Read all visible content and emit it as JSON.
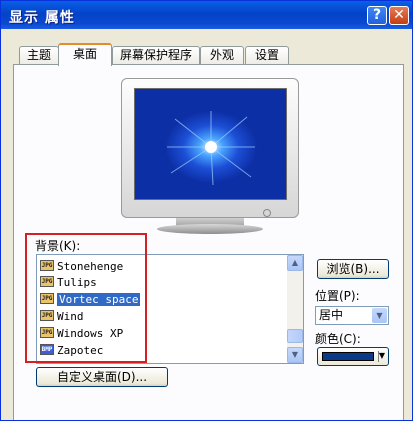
{
  "window": {
    "title": "显示 属性",
    "help_label": "?",
    "close_label": "✕"
  },
  "tabs": [
    {
      "label": "主题"
    },
    {
      "label": "桌面"
    },
    {
      "label": "屏幕保护程序"
    },
    {
      "label": "外观"
    },
    {
      "label": "设置"
    }
  ],
  "active_tab": "桌面",
  "preview": {
    "monitor_icon": "monitor-preview",
    "wallpaper": "Vortec space"
  },
  "background": {
    "label": "背景(K):",
    "items": [
      {
        "name": "Stonehenge",
        "type": "JPG"
      },
      {
        "name": "Tulips",
        "type": "JPG"
      },
      {
        "name": "Vortec space",
        "type": "JPG",
        "selected": true
      },
      {
        "name": "Wind",
        "type": "JPG"
      },
      {
        "name": "Windows XP",
        "type": "JPG"
      },
      {
        "name": "Zapotec",
        "type": "BMP"
      }
    ],
    "browse_label": "浏览(B)...",
    "position_label": "位置(P):",
    "position_value": "居中",
    "color_label": "颜色(C):",
    "color_value": "#0a3a88"
  },
  "customize_label": "自定义桌面(D)...",
  "colors": {
    "title_bar": "#0a5fe8",
    "selection": "#316ac5",
    "highlight_box": "#d32020"
  }
}
